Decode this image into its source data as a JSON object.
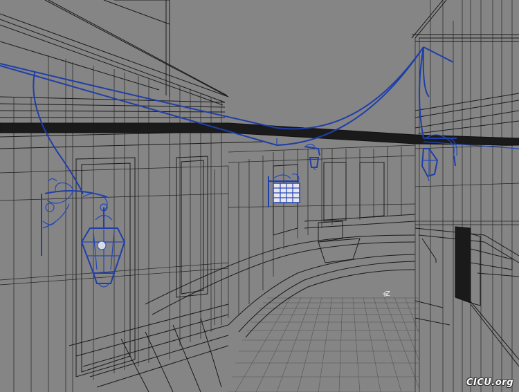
{
  "viewport": {
    "background_color": "#858585",
    "wire_color": "#1a1a1a",
    "selection_color": "#1f3ea8",
    "axis_label": "Z",
    "watermark": "CICU.org"
  },
  "objects": [
    {
      "name": "lantern-large-left",
      "selected": true
    },
    {
      "name": "lantern-sign-center",
      "selected": true
    },
    {
      "name": "lantern-small-center",
      "selected": true
    },
    {
      "name": "lantern-right",
      "selected": true
    },
    {
      "name": "hanging-cables",
      "selected": true
    }
  ]
}
